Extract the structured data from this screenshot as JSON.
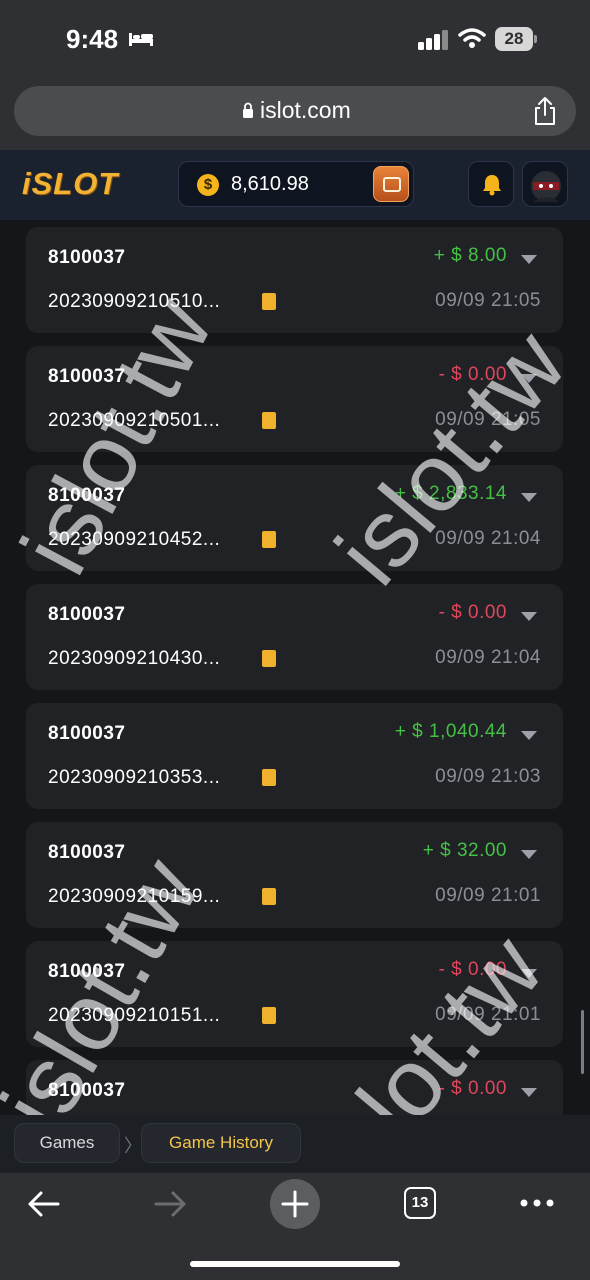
{
  "status_bar": {
    "time": "9:48",
    "battery": "28"
  },
  "browser": {
    "url": "islot.com"
  },
  "header": {
    "logo": "iSLOT",
    "balance": "8,610.98",
    "coin_symbol": "$"
  },
  "records": [
    {
      "id": "8100037",
      "order": "20230909210510...",
      "amount": "+ $ 8.00",
      "type": "win",
      "time": "09/09 21:05"
    },
    {
      "id": "8100037",
      "order": "20230909210501...",
      "amount": "- $ 0.00",
      "type": "zero",
      "time": "09/09 21:05"
    },
    {
      "id": "8100037",
      "order": "20230909210452...",
      "amount": "+ $ 2,833.14",
      "type": "win",
      "time": "09/09 21:04"
    },
    {
      "id": "8100037",
      "order": "20230909210430...",
      "amount": "- $ 0.00",
      "type": "zero",
      "time": "09/09 21:04"
    },
    {
      "id": "8100037",
      "order": "20230909210353...",
      "amount": "+ $ 1,040.44",
      "type": "win",
      "time": "09/09 21:03"
    },
    {
      "id": "8100037",
      "order": "20230909210159...",
      "amount": "+ $ 32.00",
      "type": "win",
      "time": "09/09 21:01"
    },
    {
      "id": "8100037",
      "order": "20230909210151...",
      "amount": "- $ 0.00",
      "type": "zero",
      "time": "09/09 21:01"
    },
    {
      "id": "8100037",
      "order": "",
      "amount": "- $ 0.00",
      "type": "zero",
      "time": ""
    }
  ],
  "watermark_text": "islot.tw",
  "breadcrumb": {
    "games": "Games",
    "separator": "〉",
    "current": "Game History"
  },
  "toolbar": {
    "tab_count": "13"
  },
  "colors": {
    "win": "#44c145",
    "loss": "#e0465a",
    "accent": "#f3c54b",
    "card_bg": "#202226"
  },
  "icons": [
    "bed-icon",
    "signal-icon",
    "wifi-icon",
    "lock-icon",
    "share-icon",
    "coin-icon",
    "wallet-icon",
    "bell-icon",
    "copy-icon",
    "chevron-down-icon",
    "back-arrow-icon",
    "forward-arrow-icon",
    "plus-icon",
    "more-icon"
  ]
}
